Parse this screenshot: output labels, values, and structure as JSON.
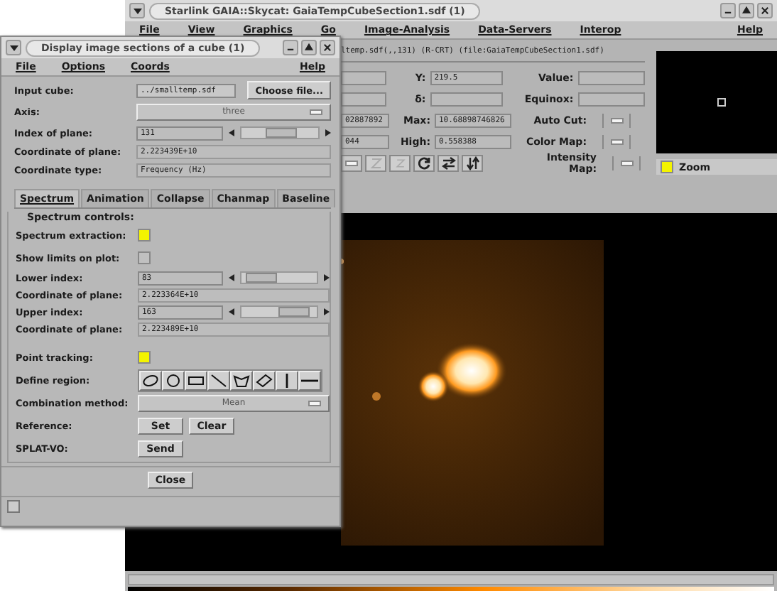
{
  "main_window": {
    "title": "Starlink GAIA::Skycat: GaiaTempCubeSection1.sdf (1)",
    "menu": [
      "File",
      "View",
      "Graphics",
      "Go",
      "Image-Analysis",
      "Data-Servers",
      "Interop",
      "Help"
    ],
    "image_path": "ltemp.sdf(,,131) (R-CRT) (file:GaiaTempCubeSection1.sdf)",
    "info_rows": [
      {
        "partial": "",
        "label": "Y:",
        "value": "219.5",
        "right_label": "Value:",
        "kind": "field"
      },
      {
        "partial": "",
        "label": "δ:",
        "value": "",
        "right_label": "Equinox:",
        "kind": "field"
      },
      {
        "partial": "02887892",
        "label": "Max:",
        "value": "10.68898746826",
        "right_label": "Auto Cut:",
        "kind": "menu"
      },
      {
        "partial": "044",
        "label": "High:",
        "value": "0.558388",
        "right_label": "Color Map:",
        "kind": "menu"
      }
    ],
    "intensity_map_label": "Intensity Map:",
    "zoom": {
      "label": "Zoom",
      "checked": true
    }
  },
  "dialog": {
    "title": "Display image sections of a cube (1)",
    "menu": [
      "File",
      "Options",
      "Coords",
      "Help"
    ],
    "input_cube": {
      "label": "Input cube:",
      "value": "../smalltemp.sdf",
      "button": "Choose file..."
    },
    "axis": {
      "label": "Axis:",
      "value": "three"
    },
    "index": {
      "label": "Index of plane:",
      "value": "131",
      "level": 0.55
    },
    "coordinate": {
      "label": "Coordinate of plane:",
      "value": "2.223439E+10"
    },
    "coordinate_type": {
      "label": "Coordinate type:",
      "value": "Frequency (Hz)"
    },
    "tabs": [
      {
        "label": "Spectrum",
        "selected": true
      },
      {
        "label": "Animation",
        "selected": false
      },
      {
        "label": "Collapse",
        "selected": false
      },
      {
        "label": "Chanmap",
        "selected": false
      },
      {
        "label": "Baseline",
        "selected": false
      }
    ],
    "spectrum_controls": {
      "title": "Spectrum controls:",
      "extraction": {
        "label": "Spectrum extraction:",
        "checked": true
      },
      "show_limits": {
        "label": "Show limits on plot:",
        "checked": false
      },
      "lower_index": {
        "label": "Lower index:",
        "value": "83",
        "level": 0.1
      },
      "lower_coordinate": {
        "label": "Coordinate of plane:",
        "value": "2.223364E+10"
      },
      "upper_index": {
        "label": "Upper index:",
        "value": "163",
        "level": 0.85
      },
      "upper_coordinate": {
        "label": "Coordinate of plane:",
        "value": "2.223489E+10"
      },
      "point_tracking": {
        "label": "Point tracking:",
        "checked": true
      },
      "define_region": {
        "label": "Define region:"
      },
      "combination": {
        "label": "Combination method:",
        "value": "Mean"
      },
      "reference": {
        "label": "Reference:",
        "buttons": [
          "Set",
          "Clear"
        ]
      },
      "splat": {
        "label": "SPLAT-VO:",
        "button": "Send"
      }
    },
    "close_button": "Close"
  }
}
